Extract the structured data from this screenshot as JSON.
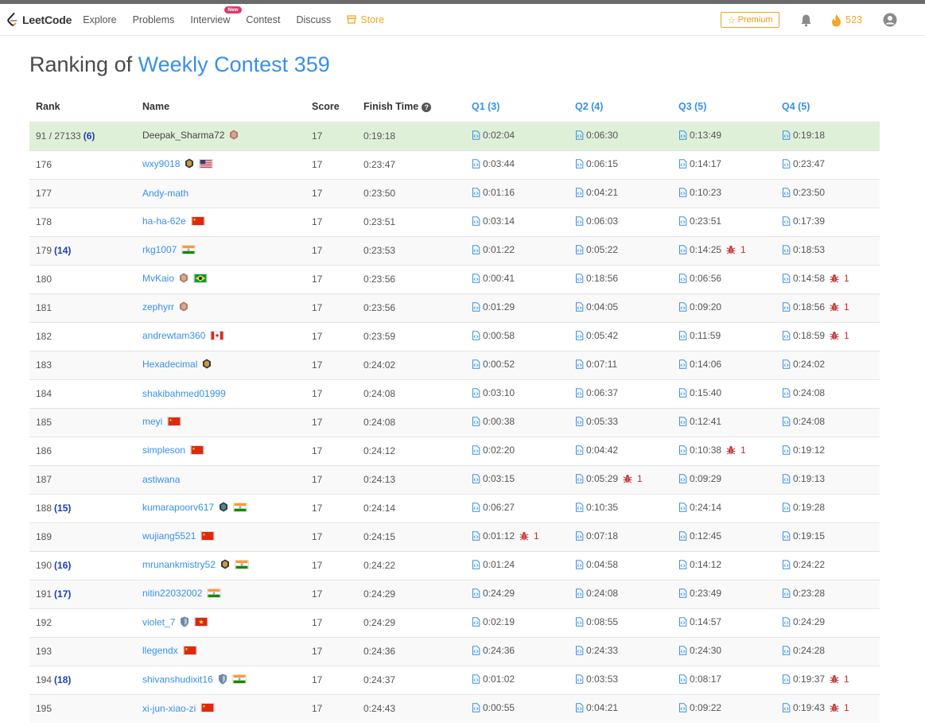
{
  "nav": {
    "brand": "LeetCode",
    "items": [
      {
        "label": "Explore"
      },
      {
        "label": "Problems"
      },
      {
        "label": "Interview",
        "badge": "New"
      },
      {
        "label": "Contest"
      },
      {
        "label": "Discuss"
      }
    ],
    "store_label": "Store",
    "premium_label": "Premium",
    "streak_count": "523",
    "icons": {
      "bell": "bell-icon",
      "flame": "flame-icon",
      "avatar": "user-avatar-icon"
    }
  },
  "page": {
    "title_prefix": "Ranking of",
    "contest_name": "Weekly Contest 359"
  },
  "table": {
    "headers": {
      "rank": "Rank",
      "name": "Name",
      "score": "Score",
      "finish": "Finish Time",
      "q1": "Q1 (3)",
      "q2": "Q2 (4)",
      "q3": "Q3 (5)",
      "q4": "Q4 (5)"
    },
    "rows": [
      {
        "rank": "91 / 27133",
        "delta": "(6)",
        "name": "Deepak_Sharma72",
        "badge": "knight",
        "flag": "",
        "score": "17",
        "finish": "0:19:18",
        "q": [
          [
            "0:02:04",
            ""
          ],
          [
            "0:06:30",
            ""
          ],
          [
            "0:13:49",
            ""
          ],
          [
            "0:19:18",
            ""
          ]
        ],
        "me": true
      },
      {
        "rank": "176",
        "delta": "",
        "name": "wxy9018",
        "badge": "guardian",
        "flag": "us",
        "score": "17",
        "finish": "0:23:47",
        "q": [
          [
            "0:03:44",
            ""
          ],
          [
            "0:06:15",
            ""
          ],
          [
            "0:14:17",
            ""
          ],
          [
            "0:23:47",
            ""
          ]
        ]
      },
      {
        "rank": "177",
        "delta": "",
        "name": "Andy-math",
        "badge": "",
        "flag": "",
        "score": "17",
        "finish": "0:23:50",
        "q": [
          [
            "0:01:16",
            ""
          ],
          [
            "0:04:21",
            ""
          ],
          [
            "0:10:23",
            ""
          ],
          [
            "0:23:50",
            ""
          ]
        ]
      },
      {
        "rank": "178",
        "delta": "",
        "name": "ha-ha-62e",
        "badge": "",
        "flag": "cn",
        "score": "17",
        "finish": "0:23:51",
        "q": [
          [
            "0:03:14",
            ""
          ],
          [
            "0:06:03",
            ""
          ],
          [
            "0:23:51",
            ""
          ],
          [
            "0:17:39",
            ""
          ]
        ]
      },
      {
        "rank": "179",
        "delta": "(14)",
        "name": "rkg1007",
        "badge": "",
        "flag": "in",
        "score": "17",
        "finish": "0:23:53",
        "q": [
          [
            "0:01:22",
            ""
          ],
          [
            "0:05:22",
            ""
          ],
          [
            "0:14:25",
            "1"
          ],
          [
            "0:18:53",
            ""
          ]
        ]
      },
      {
        "rank": "180",
        "delta": "",
        "name": "MvKaio",
        "badge": "knight",
        "flag": "br",
        "score": "17",
        "finish": "0:23:56",
        "q": [
          [
            "0:00:41",
            ""
          ],
          [
            "0:18:56",
            ""
          ],
          [
            "0:06:56",
            ""
          ],
          [
            "0:14:58",
            "1"
          ]
        ]
      },
      {
        "rank": "181",
        "delta": "",
        "name": "zephyrr",
        "badge": "knight",
        "flag": "",
        "score": "17",
        "finish": "0:23:56",
        "q": [
          [
            "0:01:29",
            ""
          ],
          [
            "0:04:05",
            ""
          ],
          [
            "0:09:20",
            ""
          ],
          [
            "0:18:56",
            "1"
          ]
        ]
      },
      {
        "rank": "182",
        "delta": "",
        "name": "andrewtam360",
        "badge": "",
        "flag": "ca",
        "score": "17",
        "finish": "0:23:59",
        "q": [
          [
            "0:00:58",
            ""
          ],
          [
            "0:05:42",
            ""
          ],
          [
            "0:11:59",
            ""
          ],
          [
            "0:18:59",
            "1"
          ]
        ]
      },
      {
        "rank": "183",
        "delta": "",
        "name": "Hexadecimal",
        "badge": "guardian",
        "flag": "",
        "score": "17",
        "finish": "0:24:02",
        "q": [
          [
            "0:00:52",
            ""
          ],
          [
            "0:07:11",
            ""
          ],
          [
            "0:14:06",
            ""
          ],
          [
            "0:24:02",
            ""
          ]
        ]
      },
      {
        "rank": "184",
        "delta": "",
        "name": "shakibahmed01999",
        "badge": "",
        "flag": "",
        "score": "17",
        "finish": "0:24:08",
        "q": [
          [
            "0:03:10",
            ""
          ],
          [
            "0:06:37",
            ""
          ],
          [
            "0:15:40",
            ""
          ],
          [
            "0:24:08",
            ""
          ]
        ]
      },
      {
        "rank": "185",
        "delta": "",
        "name": "meyi",
        "badge": "",
        "flag": "cn",
        "score": "17",
        "finish": "0:24:08",
        "q": [
          [
            "0:00:38",
            ""
          ],
          [
            "0:05:33",
            ""
          ],
          [
            "0:12:41",
            ""
          ],
          [
            "0:24:08",
            ""
          ]
        ]
      },
      {
        "rank": "186",
        "delta": "",
        "name": "simpleson",
        "badge": "",
        "flag": "cn",
        "score": "17",
        "finish": "0:24:12",
        "q": [
          [
            "0:02:20",
            ""
          ],
          [
            "0:04:42",
            ""
          ],
          [
            "0:10:38",
            "1"
          ],
          [
            "0:19:12",
            ""
          ]
        ]
      },
      {
        "rank": "187",
        "delta": "",
        "name": "astiwana",
        "badge": "",
        "flag": "",
        "score": "17",
        "finish": "0:24:13",
        "q": [
          [
            "0:03:15",
            ""
          ],
          [
            "0:05:29",
            "1"
          ],
          [
            "0:09:29",
            ""
          ],
          [
            "0:19:13",
            ""
          ]
        ]
      },
      {
        "rank": "188",
        "delta": "(15)",
        "name": "kumarapoorv617",
        "badge": "guardian-teal",
        "flag": "in",
        "score": "17",
        "finish": "0:24:14",
        "q": [
          [
            "0:06:27",
            ""
          ],
          [
            "0:10:35",
            ""
          ],
          [
            "0:24:14",
            ""
          ],
          [
            "0:19:28",
            ""
          ]
        ]
      },
      {
        "rank": "189",
        "delta": "",
        "name": "wujiang5521",
        "badge": "",
        "flag": "cn",
        "score": "17",
        "finish": "0:24:15",
        "q": [
          [
            "0:01:12",
            "1"
          ],
          [
            "0:07:18",
            ""
          ],
          [
            "0:12:45",
            ""
          ],
          [
            "0:19:15",
            ""
          ]
        ]
      },
      {
        "rank": "190",
        "delta": "(16)",
        "name": "mrunankmistry52",
        "badge": "guardian",
        "flag": "in",
        "score": "17",
        "finish": "0:24:22",
        "q": [
          [
            "0:01:24",
            ""
          ],
          [
            "0:04:58",
            ""
          ],
          [
            "0:14:12",
            ""
          ],
          [
            "0:24:22",
            ""
          ]
        ]
      },
      {
        "rank": "191",
        "delta": "(17)",
        "name": "nitin22032002",
        "badge": "",
        "flag": "in",
        "score": "17",
        "finish": "0:24:29",
        "q": [
          [
            "0:24:29",
            ""
          ],
          [
            "0:24:08",
            ""
          ],
          [
            "0:23:49",
            ""
          ],
          [
            "0:23:28",
            ""
          ]
        ]
      },
      {
        "rank": "192",
        "delta": "",
        "name": "violet_7",
        "badge": "shield",
        "flag": "vn",
        "score": "17",
        "finish": "0:24:29",
        "q": [
          [
            "0:02:19",
            ""
          ],
          [
            "0:08:55",
            ""
          ],
          [
            "0:14:57",
            ""
          ],
          [
            "0:24:29",
            ""
          ]
        ]
      },
      {
        "rank": "193",
        "delta": "",
        "name": "llegendx",
        "badge": "",
        "flag": "cn",
        "score": "17",
        "finish": "0:24:36",
        "q": [
          [
            "0:24:36",
            ""
          ],
          [
            "0:24:33",
            ""
          ],
          [
            "0:24:30",
            ""
          ],
          [
            "0:24:28",
            ""
          ]
        ]
      },
      {
        "rank": "194",
        "delta": "(18)",
        "name": "shivanshudixit16",
        "badge": "shield",
        "flag": "in",
        "score": "17",
        "finish": "0:24:37",
        "q": [
          [
            "0:01:02",
            ""
          ],
          [
            "0:03:53",
            ""
          ],
          [
            "0:08:17",
            ""
          ],
          [
            "0:19:37",
            "1"
          ]
        ]
      },
      {
        "rank": "195",
        "delta": "",
        "name": "xi-jun-xiao-zi",
        "badge": "",
        "flag": "cn",
        "score": "17",
        "finish": "0:24:43",
        "q": [
          [
            "0:00:55",
            ""
          ],
          [
            "0:04:21",
            ""
          ],
          [
            "0:09:22",
            ""
          ],
          [
            "0:19:43",
            "1"
          ]
        ]
      }
    ]
  },
  "colors": {
    "link": "#3890e8",
    "highlight_row": "#dff0d8",
    "bug": "#c72e2e",
    "accent": "#f5a623"
  }
}
